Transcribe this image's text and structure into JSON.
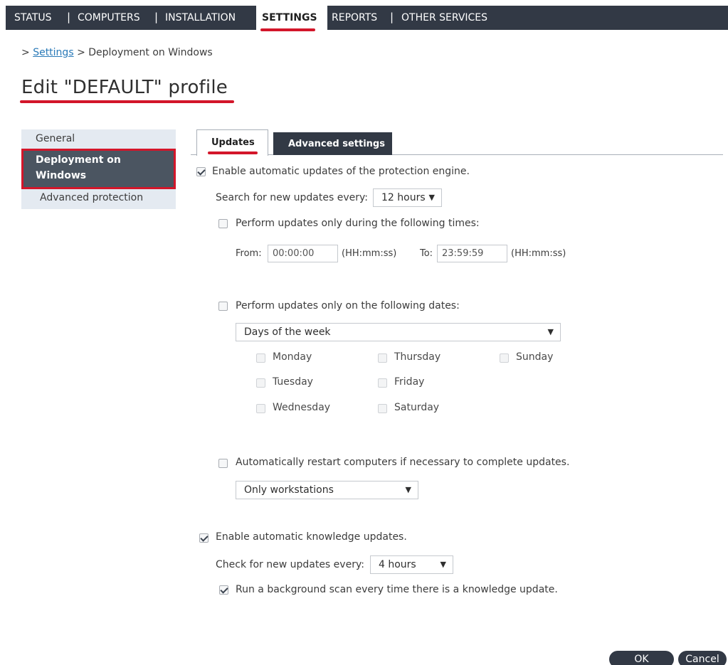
{
  "nav": {
    "items": [
      "STATUS",
      "COMPUTERS",
      "INSTALLATION",
      "SETTINGS",
      "REPORTS",
      "OTHER SERVICES"
    ],
    "separator": "|",
    "active": "SETTINGS"
  },
  "breadcrumb": {
    "prefix": ">",
    "link": "Settings",
    "current": "> Deployment on Windows"
  },
  "page_title": "Edit \"DEFAULT\" profile",
  "sidebar": {
    "items": [
      "General",
      "Deployment on Windows",
      "Advanced protection"
    ],
    "active": "Deployment on Windows"
  },
  "tabs": {
    "updates": "Updates",
    "advanced": "Advanced settings"
  },
  "engine": {
    "enable_label": "Enable automatic updates of the protection engine.",
    "enable_checked": true,
    "search_label": "Search for new updates every:",
    "search_value": "12 hours",
    "times_label": "Perform updates only during the following times:",
    "times_checked": false,
    "from_label": "From:",
    "from_value": "00:00:00",
    "from_hint": "(HH:mm:ss)",
    "to_label": "To:",
    "to_value": "23:59:59",
    "to_hint": "(HH:mm:ss)",
    "dates_label": "Perform updates only on the following dates:",
    "dates_checked": false,
    "dates_select": "Days of the week",
    "days": {
      "monday": "Monday",
      "tuesday": "Tuesday",
      "wednesday": "Wednesday",
      "thursday": "Thursday",
      "friday": "Friday",
      "saturday": "Saturday",
      "sunday": "Sunday"
    },
    "restart_label": "Automatically restart computers if necessary to complete updates.",
    "restart_checked": false,
    "restart_select": "Only workstations"
  },
  "knowledge": {
    "enable_label": "Enable automatic knowledge updates.",
    "enable_checked": true,
    "check_label": "Check for new updates every:",
    "check_value": "4 hours",
    "scan_label": "Run a background scan every time there is a knowledge update.",
    "scan_checked": true
  },
  "buttons": {
    "ok": "OK",
    "cancel": "Cancel"
  },
  "icons": {
    "dropdown": "▼"
  },
  "colors": {
    "nav_bg": "#323945",
    "highlight_red": "#d3162a",
    "link_blue": "#2a7ab8",
    "sidebar_bg": "#e4eaf1"
  }
}
